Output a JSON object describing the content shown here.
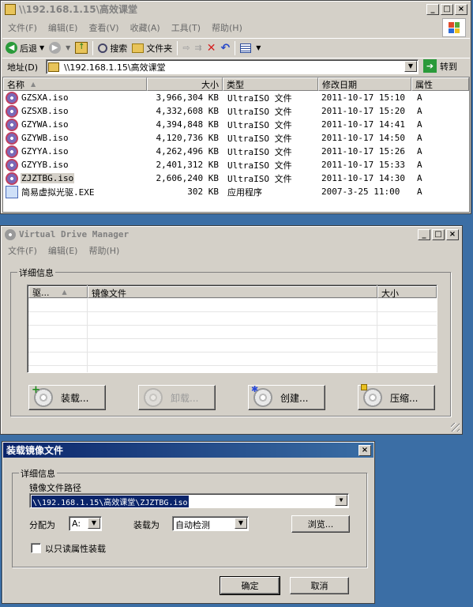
{
  "explorer": {
    "title": "\\\\192.168.1.15\\高效课堂",
    "menu": [
      "文件(F)",
      "编辑(E)",
      "查看(V)",
      "收藏(A)",
      "工具(T)",
      "帮助(H)"
    ],
    "toolbar": {
      "back": "后退",
      "search": "搜索",
      "folders": "文件夹"
    },
    "address_label": "地址(D)",
    "address_value": "\\\\192.168.1.15\\高效课堂",
    "go": "转到",
    "columns": [
      "名称",
      "大小",
      "类型",
      "修改日期",
      "属性"
    ],
    "files": [
      {
        "name": "GZSXA.iso",
        "size": "3,966,304 KB",
        "type": "UltraISO 文件",
        "date": "2011-10-17 15:10",
        "attr": "A"
      },
      {
        "name": "GZSXB.iso",
        "size": "4,332,608 KB",
        "type": "UltraISO 文件",
        "date": "2011-10-17 15:20",
        "attr": "A"
      },
      {
        "name": "GZYWA.iso",
        "size": "4,394,848 KB",
        "type": "UltraISO 文件",
        "date": "2011-10-17 14:41",
        "attr": "A"
      },
      {
        "name": "GZYWB.iso",
        "size": "4,120,736 KB",
        "type": "UltraISO 文件",
        "date": "2011-10-17 14:50",
        "attr": "A"
      },
      {
        "name": "GZYYA.iso",
        "size": "4,262,496 KB",
        "type": "UltraISO 文件",
        "date": "2011-10-17 15:26",
        "attr": "A"
      },
      {
        "name": "GZYYB.iso",
        "size": "2,401,312 KB",
        "type": "UltraISO 文件",
        "date": "2011-10-17 15:33",
        "attr": "A"
      },
      {
        "name": "ZJZTBG.iso",
        "size": "2,606,240 KB",
        "type": "UltraISO 文件",
        "date": "2011-10-17 14:30",
        "attr": "A"
      },
      {
        "name": "简易虚拟光驱.EXE",
        "size": "302 KB",
        "type": "应用程序",
        "date": "2007-3-25 11:00",
        "attr": "A"
      }
    ]
  },
  "vdm": {
    "title": "Virtual Drive Manager",
    "menu": [
      "文件(F)",
      "编辑(E)",
      "帮助(H)"
    ],
    "group": "详细信息",
    "columns": [
      "驱...",
      "镜像文件",
      "大小"
    ],
    "buttons": {
      "mount": "装载...",
      "unmount": "卸载...",
      "create": "创建...",
      "compress": "压缩..."
    }
  },
  "dialog": {
    "title": "装载镜像文件",
    "group": "详细信息",
    "path_label": "镜像文件路径",
    "path_value": "\\\\192.168.1.15\\高效课堂\\ZJZTBG.iso",
    "assign_label": "分配为",
    "assign_value": "A:",
    "mount_as_label": "装载为",
    "mount_as_value": "自动检测",
    "browse": "浏览...",
    "readonly": "以只读属性装载",
    "ok": "确定",
    "cancel": "取消"
  }
}
